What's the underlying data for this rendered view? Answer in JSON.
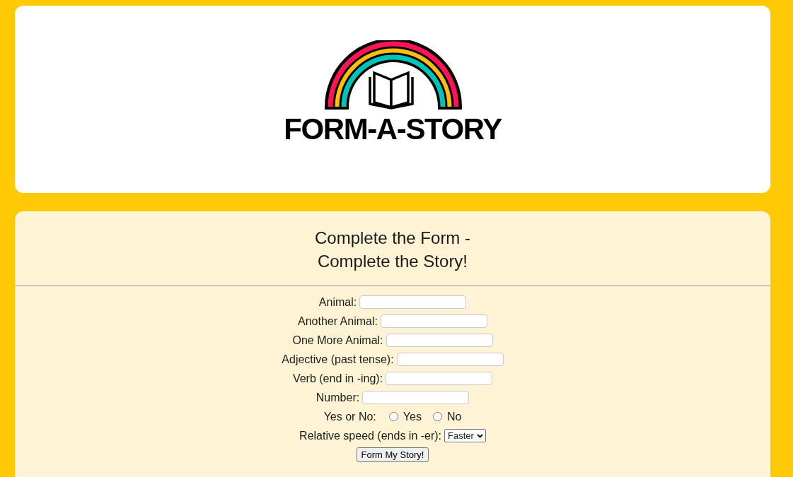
{
  "logo": {
    "title": "FORM-A-STORY"
  },
  "form": {
    "heading": [
      "Complete the Form -",
      "Complete the Story!"
    ],
    "fields": [
      {
        "kind": "text",
        "label": "Animal:"
      },
      {
        "kind": "text",
        "label": "Another Animal:"
      },
      {
        "kind": "text",
        "label": "One More Animal:"
      },
      {
        "kind": "text",
        "label": "Adjective (past tense):"
      },
      {
        "kind": "text",
        "label": "Verb (end in -ing):"
      },
      {
        "kind": "text",
        "label": "Number:"
      },
      {
        "kind": "radio",
        "label": "Yes or No:",
        "options": [
          {
            "label": "Yes",
            "selected": false
          },
          {
            "label": "No",
            "selected": false
          }
        ]
      },
      {
        "kind": "select",
        "label": "Relative speed (ends in -er):",
        "value": "Faster"
      }
    ],
    "submit": "Form My Story!"
  }
}
